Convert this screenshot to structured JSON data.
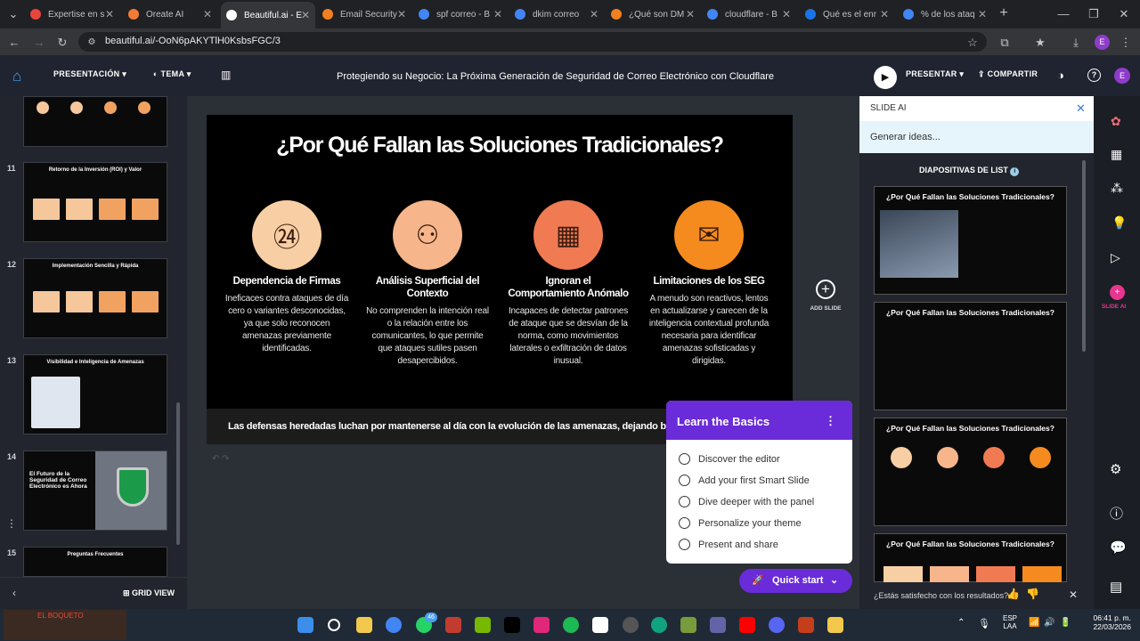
{
  "browser": {
    "tabs": [
      {
        "label": "Expertise en s",
        "color": "#e8453c"
      },
      {
        "label": "Oreate AI",
        "color": "#f27b35"
      },
      {
        "label": "Beautiful.ai - E",
        "color": "#ffffff"
      },
      {
        "label": "Email Security",
        "color": "#f38020"
      },
      {
        "label": "spf correo - B",
        "color": "#4285f4"
      },
      {
        "label": "dkim correo",
        "color": "#4285f4"
      },
      {
        "label": "¿Qué son DM",
        "color": "#f38020"
      },
      {
        "label": "cloudflare - B",
        "color": "#4285f4"
      },
      {
        "label": "Qué es el enr",
        "color": "#1a73e8"
      },
      {
        "label": "% de los ataq",
        "color": "#4285f4"
      }
    ],
    "new_tab": "+",
    "url": "beautiful.ai/-OoN6pAKYTlH0KsbsFGC/3",
    "profile_initial": "E"
  },
  "header": {
    "presentacion": "PRESENTACIÓN",
    "tema": "TEMA",
    "title": "Protegiendo su Negocio: La Próxima Generación de Seguridad de Correo Electrónico con Cloudflare",
    "presentar": "PRESENTAR",
    "compartir": "COMPARTIR",
    "avatar": "E"
  },
  "left_panel": {
    "thumbs": [
      {
        "num": "",
        "title": ""
      },
      {
        "num": "11",
        "title": "Retorno de la Inversión (ROI) y Valor"
      },
      {
        "num": "12",
        "title": "Implementación Sencilla y Rápida"
      },
      {
        "num": "13",
        "title": "Visibilidad e Inteligencia de Amenazas"
      },
      {
        "num": "14",
        "title": "El Futuro de la Seguridad de Correo Electrónico es Ahora"
      },
      {
        "num": "15",
        "title": "Preguntas Frecuentes"
      }
    ],
    "grid_view": "GRID VIEW"
  },
  "slide": {
    "title": "¿Por Qué Fallan las Soluciones Tradicionales?",
    "columns": [
      {
        "title": "Dependencia de Firmas",
        "desc": "Ineficaces contra ataques de día cero o variantes desconocidas, ya que solo reconocen amenazas previamente identificadas.",
        "color": "#f8cfa4"
      },
      {
        "title": "Análisis Superficial del Contexto",
        "desc": "No comprenden la intención real o la relación entre los comunicantes, lo que permite que ataques sutiles pasen desapercibidos.",
        "color": "#f6b58a"
      },
      {
        "title": "Ignoran el Comportamiento Anómalo",
        "desc": "Incapaces de detectar patrones de ataque que se desvían de la norma, como movimientos laterales o exfiltración de datos inusual.",
        "color": "#f07a52"
      },
      {
        "title": "Limitaciones de los SEG",
        "desc": "A menudo son reactivos, lentos en actualizarse y carecen de la inteligencia contextual profunda necesaria para identificar amenazas sofisticadas y dirigidas.",
        "color": "#f58b1f"
      }
    ],
    "footer": "Las defensas heredadas luchan por mantenerse al día con la evolución de las amenazas, dejando brechas sig"
  },
  "add_slide": "ADD SLIDE",
  "learn": {
    "title": "Learn the Basics",
    "items": [
      "Discover the editor",
      "Add your first Smart Slide",
      "Dive deeper with the panel",
      "Personalize your theme",
      "Present and share"
    ],
    "quick_start": "Quick start"
  },
  "right_panel": {
    "header": "SLIDE AI",
    "input_placeholder": "Generar ideas...",
    "section": "DIAPOSITIVAS DE LIST",
    "thumb_title": "¿Por Qué Fallan las Soluciones Tradicionales?",
    "feedback": "¿Estás satisfecho con los resultados?"
  },
  "far_right": {
    "slide_ai_label": "SLIDE AI"
  },
  "taskbar": {
    "lang": "ESP",
    "lang2": "LAA",
    "time": "06:41 p. m.",
    "date": "22/03/2026",
    "badge": "46",
    "video_label": "EL BOQUETO"
  }
}
